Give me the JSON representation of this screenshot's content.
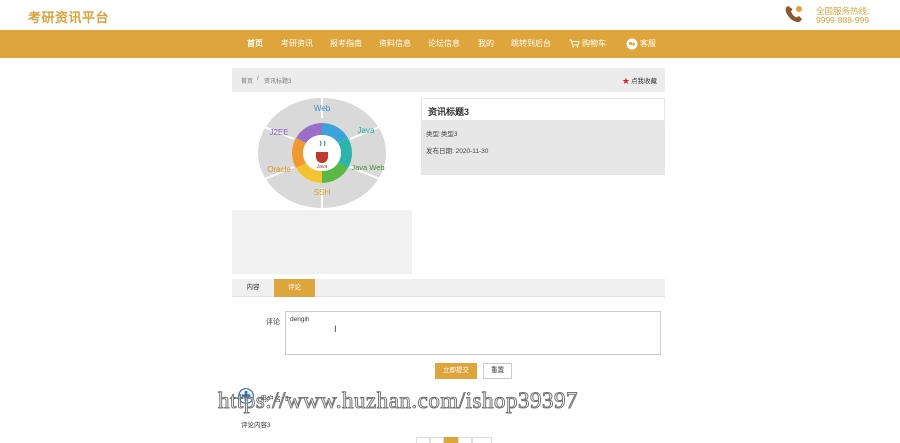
{
  "header": {
    "logo_text": "考研资讯平台",
    "hotline_label": "全国服务热线:",
    "hotline_number": "9999-888-999"
  },
  "nav": {
    "items": [
      {
        "label": "首页"
      },
      {
        "label": "考研资讯"
      },
      {
        "label": "报考指南"
      },
      {
        "label": "资料信息"
      },
      {
        "label": "论坛信息"
      },
      {
        "label": "我的"
      },
      {
        "label": "跳转到后台"
      },
      {
        "label": "购物车"
      },
      {
        "label": "客服"
      }
    ]
  },
  "breadcrumb": {
    "home": "首页",
    "sep": "/",
    "current": "资讯标题3"
  },
  "favorite_label": "点我收藏",
  "article": {
    "title": "资讯标题3",
    "category_label": "类型:",
    "category_value": "类型3",
    "date_label": "发布日期:",
    "date_value": "2020-11-30"
  },
  "image_labels": {
    "center": "Java",
    "segments": [
      "Web",
      "Java",
      "Java Web",
      "SSH",
      "Oracle",
      "J2EE"
    ]
  },
  "tabs": [
    {
      "label": "内容"
    },
    {
      "label": "评论"
    }
  ],
  "comment_form": {
    "label": "评论",
    "value": "dengih",
    "submit": "立即提交",
    "reset": "重置"
  },
  "comments": [
    {
      "user": "用户名: 3",
      "content": "评论内容3"
    }
  ],
  "watermark": "https://www.huzhan.com/ishop39397",
  "colors": {
    "accent": "#dea53d",
    "logo": "#d9a240",
    "fav_star": "#d9242a"
  }
}
